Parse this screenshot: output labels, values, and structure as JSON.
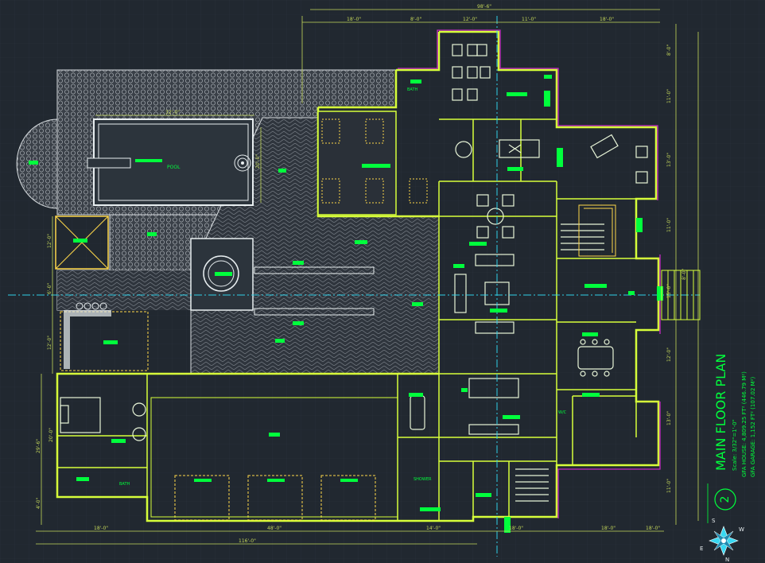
{
  "plan": {
    "title": "MAIN FLOOR PLAN",
    "scale": "Scale: 3/32\"=1'-0\"",
    "gfa_house": "GFA HOUSE: 4,809.25 FT² (446.79 M²)",
    "gfa_garage": "GFA GARAGE: 1,152 FT² (107.02 M²)",
    "number": "2"
  },
  "room_labels": {
    "pool": "POOL",
    "bath_upper": "BATH",
    "bath_lower": "BATH",
    "shower": "SHOWER",
    "cloak": "W/C"
  },
  "dimensions": {
    "top_overall": "98'-6\"",
    "top_segments": [
      "18'-0\"",
      "8'-0\"",
      "12'-0\"",
      "11'-0\"",
      "18'-0\""
    ],
    "bottom_overall": "116'-0\"",
    "bottom_segments": [
      "18'-0\"",
      "48'-0\"",
      "14'-0\"",
      "18'-0\"",
      "18'-0\"",
      "18'-0\""
    ],
    "pool_width": "32'-0\"",
    "pool_depth": "20'-0\"",
    "right_segments": [
      "8'-0\"",
      "11'-0\"",
      "13'-0\"",
      "11'-0\"",
      "15'-0\"",
      "12'-0\"",
      "13'-0\"",
      "11'-0\"",
      "8'-0\""
    ],
    "left_segments": [
      "12'-0\"",
      "6'-0\"",
      "12'-0\"",
      "20'-0\"",
      "29'-6\"",
      "4'-0\""
    ]
  },
  "compass": {
    "n": "N",
    "s": "S",
    "e": "E",
    "w": "W"
  },
  "colors": {
    "background": "#212830",
    "wall": "#d7ff3a",
    "furniture": "#e8f5d8",
    "label": "#00ff3c",
    "dimension": "#c5d85a",
    "axis": "#2fd0e8",
    "property": "#c62ac4",
    "pattern": "#8a8f96",
    "compass": "#38d8f2"
  }
}
